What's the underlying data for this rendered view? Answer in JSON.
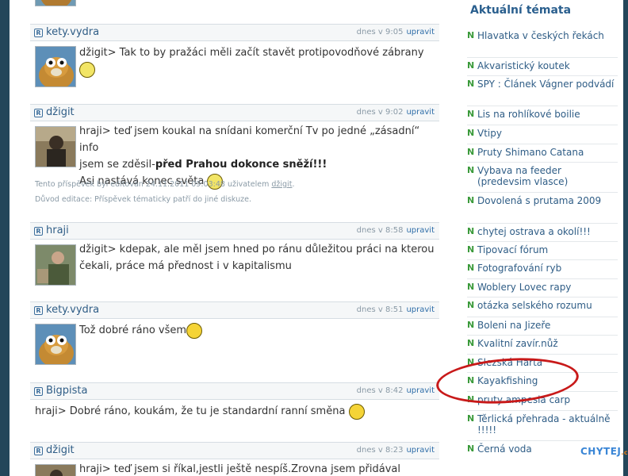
{
  "posts": [
    {
      "username": "kety.vydra",
      "time": "dnes v 9:05",
      "edit_label": "upravit",
      "lines": [
        "džigit> Tak to by pražáci měli začít stavět protipovodňové zábrany"
      ],
      "avatar": "otter-avatar"
    },
    {
      "username": "džigit",
      "time": "dnes v 9:02",
      "edit_label": "upravit",
      "line1": "hraji> teď jsem koukal na snídani komerční Tv po jedné „zásadní“ info",
      "line2_pre": "jsem se zděsil-",
      "line2_bold": "před Prahou dokonce sněží!!!",
      "line3": "Asi nastává konec světa",
      "edit_note_1_pre": "Tento příspěvek byl editován 24.11.2011 09:03:48 uživatelem ",
      "edit_note_1_user": "džigit",
      "edit_note_1_post": ".",
      "edit_note_2": "Důvod editace: Příspěvek tématicky patří do jiné diskuze.",
      "avatar": "person-avatar"
    },
    {
      "username": "hraji",
      "time": "dnes v 8:58",
      "edit_label": "upravit",
      "lines": [
        "džigit> kdepak, ale měl jsem hned po ránu důležitou práci na kterou",
        "čekali, práce má přednost i v kapitalismu"
      ],
      "avatar": "person-avatar"
    },
    {
      "username": "kety.vydra",
      "time": "dnes v 8:51",
      "edit_label": "upravit",
      "lines": [
        "Tož dobré ráno všem"
      ],
      "avatar": "otter-avatar"
    },
    {
      "username": "Bigpista",
      "time": "dnes v 8:42",
      "edit_label": "upravit",
      "lines": [
        "hraji> Dobré ráno, koukám, že tu je standardní ranní směna"
      ]
    },
    {
      "username": "džigit",
      "time": "dnes v 8:23",
      "edit_label": "upravit",
      "lines": [
        "hraji> teď jsem si říkal,jestli ještě nespíš.Zrovna jsem přidával zprávy"
      ],
      "avatar": "person-avatar"
    }
  ],
  "sidebar": {
    "title": "Aktuální témata",
    "new_marker": "N",
    "topics": [
      "Hlavatka v českých řekách",
      "Akvaristický koutek",
      "SPY : Článek Vágner podvádí",
      "Lis na rohlíkové boilie",
      "Vtipy",
      "Pruty Shimano Catana",
      "Vybava na feeder (predevsim vlasce)",
      "Dovolená s prutama 2009",
      "chytej ostrava a okolí!!!",
      "Tipovací fórum",
      "Fotografování ryb",
      "Woblery Lovec rapy",
      "otázka selského rozumu",
      "Boleni na Jizeře",
      "Kvalitní zavír.nůž",
      "Slezská Harta",
      "Kayakfishing",
      "pruty ampesia carp",
      "Těrlická přehrada - aktuálně !!!!!",
      "Černá voda"
    ]
  },
  "brand": {
    "name": "CHYTEJ",
    "tld": ".cz"
  }
}
